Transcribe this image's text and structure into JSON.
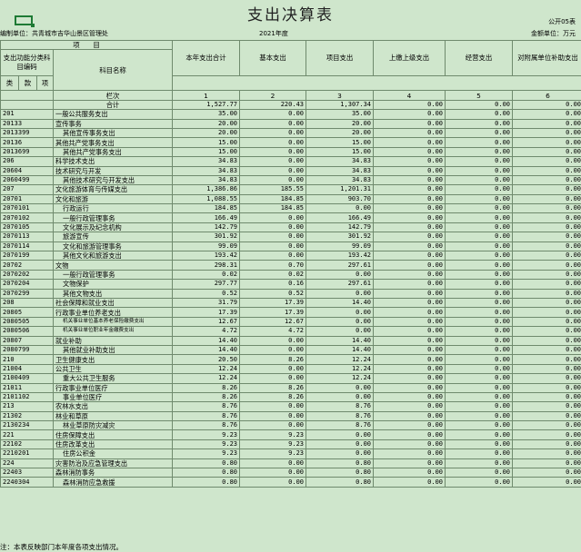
{
  "sheet": {
    "title": "支出决算表",
    "form_code": "公开05表",
    "unit_label": "编制单位：",
    "unit_name": "共青城市吉华山景区管理处",
    "year": "2021年度",
    "money_unit": "金额单位：万元",
    "note": "注：本表反映部门本年度各项支出情况。"
  },
  "header": {
    "item": "项　　目",
    "code_col": "支出功能分类科目编码",
    "name_col": "科目名称",
    "total_col": "本年支出合计",
    "basic_col": "基本支出",
    "project_col": "项目支出",
    "upper_col": "上缴上级支出",
    "business_col": "经营支出",
    "subsidy_col": "对附属单位补助支出",
    "lei": "类",
    "kuan": "款",
    "xiang": "项",
    "row_label": "栏次",
    "col_nums": [
      "1",
      "2",
      "3",
      "4",
      "5",
      "6"
    ]
  },
  "rows": [
    {
      "code": "",
      "name": "合计",
      "total": "1,527.77",
      "basic": "220.43",
      "project": "1,307.34",
      "upper": "0.00",
      "business": "0.00",
      "subsidy": "0.00",
      "style": "ctr"
    },
    {
      "code": "201",
      "name": "一般公共服务支出",
      "total": "35.00",
      "basic": "0.00",
      "project": "35.00",
      "upper": "0.00",
      "business": "0.00",
      "subsidy": "0.00",
      "style": ""
    },
    {
      "code": "20133",
      "name": "宣传事务",
      "total": "20.00",
      "basic": "0.00",
      "project": "20.00",
      "upper": "0.00",
      "business": "0.00",
      "subsidy": "0.00",
      "style": ""
    },
    {
      "code": "2013399",
      "name": "其他宣传事务支出",
      "total": "20.00",
      "basic": "0.00",
      "project": "20.00",
      "upper": "0.00",
      "business": "0.00",
      "subsidy": "0.00",
      "style": "ind1"
    },
    {
      "code": "20136",
      "name": "其他共产党事务支出",
      "total": "15.00",
      "basic": "0.00",
      "project": "15.00",
      "upper": "0.00",
      "business": "0.00",
      "subsidy": "0.00",
      "style": ""
    },
    {
      "code": "2013699",
      "name": "其他共产党事务支出",
      "total": "15.00",
      "basic": "0.00",
      "project": "15.00",
      "upper": "0.00",
      "business": "0.00",
      "subsidy": "0.00",
      "style": "ind1"
    },
    {
      "code": "206",
      "name": "科学技术支出",
      "total": "34.83",
      "basic": "0.00",
      "project": "34.83",
      "upper": "0.00",
      "business": "0.00",
      "subsidy": "0.00",
      "style": ""
    },
    {
      "code": "20604",
      "name": "技术研究与开发",
      "total": "34.83",
      "basic": "0.00",
      "project": "34.83",
      "upper": "0.00",
      "business": "0.00",
      "subsidy": "0.00",
      "style": ""
    },
    {
      "code": "2060499",
      "name": "其他技术研究与开发支出",
      "total": "34.83",
      "basic": "0.00",
      "project": "34.83",
      "upper": "0.00",
      "business": "0.00",
      "subsidy": "0.00",
      "style": "ind1"
    },
    {
      "code": "207",
      "name": "文化旅游体育与传媒支出",
      "total": "1,386.86",
      "basic": "185.55",
      "project": "1,201.31",
      "upper": "0.00",
      "business": "0.00",
      "subsidy": "0.00",
      "style": ""
    },
    {
      "code": "20701",
      "name": "文化和旅游",
      "total": "1,088.55",
      "basic": "184.85",
      "project": "903.70",
      "upper": "0.00",
      "business": "0.00",
      "subsidy": "0.00",
      "style": ""
    },
    {
      "code": "2070101",
      "name": "行政运行",
      "total": "184.85",
      "basic": "184.85",
      "project": "0.00",
      "upper": "0.00",
      "business": "0.00",
      "subsidy": "0.00",
      "style": "ind1"
    },
    {
      "code": "2070102",
      "name": "一般行政管理事务",
      "total": "166.49",
      "basic": "0.00",
      "project": "166.49",
      "upper": "0.00",
      "business": "0.00",
      "subsidy": "0.00",
      "style": "ind1"
    },
    {
      "code": "2070105",
      "name": "文化展示及纪念机构",
      "total": "142.79",
      "basic": "0.00",
      "project": "142.79",
      "upper": "0.00",
      "business": "0.00",
      "subsidy": "0.00",
      "style": "ind1"
    },
    {
      "code": "2070113",
      "name": "旅游宣传",
      "total": "301.92",
      "basic": "0.00",
      "project": "301.92",
      "upper": "0.00",
      "business": "0.00",
      "subsidy": "0.00",
      "style": "ind1"
    },
    {
      "code": "2070114",
      "name": "文化和旅游管理事务",
      "total": "99.09",
      "basic": "0.00",
      "project": "99.09",
      "upper": "0.00",
      "business": "0.00",
      "subsidy": "0.00",
      "style": "ind1"
    },
    {
      "code": "2070199",
      "name": "其他文化和旅游支出",
      "total": "193.42",
      "basic": "0.00",
      "project": "193.42",
      "upper": "0.00",
      "business": "0.00",
      "subsidy": "0.00",
      "style": "ind1"
    },
    {
      "code": "20702",
      "name": "文物",
      "total": "298.31",
      "basic": "0.70",
      "project": "297.61",
      "upper": "0.00",
      "business": "0.00",
      "subsidy": "0.00",
      "style": ""
    },
    {
      "code": "2070202",
      "name": "一般行政管理事务",
      "total": "0.02",
      "basic": "0.02",
      "project": "0.00",
      "upper": "0.00",
      "business": "0.00",
      "subsidy": "0.00",
      "style": "ind1"
    },
    {
      "code": "2070204",
      "name": "文物保护",
      "total": "297.77",
      "basic": "0.16",
      "project": "297.61",
      "upper": "0.00",
      "business": "0.00",
      "subsidy": "0.00",
      "style": "ind1"
    },
    {
      "code": "2070299",
      "name": "其他文物支出",
      "total": "0.52",
      "basic": "0.52",
      "project": "0.00",
      "upper": "0.00",
      "business": "0.00",
      "subsidy": "0.00",
      "style": "ind1"
    },
    {
      "code": "208",
      "name": "社会保障和就业支出",
      "total": "31.79",
      "basic": "17.39",
      "project": "14.40",
      "upper": "0.00",
      "business": "0.00",
      "subsidy": "0.00",
      "style": ""
    },
    {
      "code": "20805",
      "name": "行政事业单位养老支出",
      "total": "17.39",
      "basic": "17.39",
      "project": "0.00",
      "upper": "0.00",
      "business": "0.00",
      "subsidy": "0.00",
      "style": ""
    },
    {
      "code": "2080505",
      "name": "机关事业单位基本养老保险缴费支出",
      "total": "12.67",
      "basic": "12.67",
      "project": "0.00",
      "upper": "0.00",
      "business": "0.00",
      "subsidy": "0.00",
      "style": "tiny"
    },
    {
      "code": "2080506",
      "name": "机关事业单位职业年金缴费支出",
      "total": "4.72",
      "basic": "4.72",
      "project": "0.00",
      "upper": "0.00",
      "business": "0.00",
      "subsidy": "0.00",
      "style": "tiny"
    },
    {
      "code": "20807",
      "name": "就业补助",
      "total": "14.40",
      "basic": "0.00",
      "project": "14.40",
      "upper": "0.00",
      "business": "0.00",
      "subsidy": "0.00",
      "style": ""
    },
    {
      "code": "2080799",
      "name": "其他就业补助支出",
      "total": "14.40",
      "basic": "0.00",
      "project": "14.40",
      "upper": "0.00",
      "business": "0.00",
      "subsidy": "0.00",
      "style": "ind1"
    },
    {
      "code": "210",
      "name": "卫生健康支出",
      "total": "20.50",
      "basic": "8.26",
      "project": "12.24",
      "upper": "0.00",
      "business": "0.00",
      "subsidy": "0.00",
      "style": ""
    },
    {
      "code": "21004",
      "name": "公共卫生",
      "total": "12.24",
      "basic": "0.00",
      "project": "12.24",
      "upper": "0.00",
      "business": "0.00",
      "subsidy": "0.00",
      "style": ""
    },
    {
      "code": "2100409",
      "name": "重大公共卫生服务",
      "total": "12.24",
      "basic": "0.00",
      "project": "12.24",
      "upper": "0.00",
      "business": "0.00",
      "subsidy": "0.00",
      "style": "ind1"
    },
    {
      "code": "21011",
      "name": "行政事业单位医疗",
      "total": "8.26",
      "basic": "8.26",
      "project": "0.00",
      "upper": "0.00",
      "business": "0.00",
      "subsidy": "0.00",
      "style": ""
    },
    {
      "code": "2101102",
      "name": "事业单位医疗",
      "total": "8.26",
      "basic": "8.26",
      "project": "0.00",
      "upper": "0.00",
      "business": "0.00",
      "subsidy": "0.00",
      "style": "ind1"
    },
    {
      "code": "213",
      "name": "农林水支出",
      "total": "8.76",
      "basic": "0.00",
      "project": "8.76",
      "upper": "0.00",
      "business": "0.00",
      "subsidy": "0.00",
      "style": ""
    },
    {
      "code": "21302",
      "name": "林业和草原",
      "total": "8.76",
      "basic": "0.00",
      "project": "8.76",
      "upper": "0.00",
      "business": "0.00",
      "subsidy": "0.00",
      "style": ""
    },
    {
      "code": "2130234",
      "name": "林业草原防灾减灾",
      "total": "8.76",
      "basic": "0.00",
      "project": "8.76",
      "upper": "0.00",
      "business": "0.00",
      "subsidy": "0.00",
      "style": "ind1"
    },
    {
      "code": "221",
      "name": "住房保障支出",
      "total": "9.23",
      "basic": "9.23",
      "project": "0.00",
      "upper": "0.00",
      "business": "0.00",
      "subsidy": "0.00",
      "style": ""
    },
    {
      "code": "22102",
      "name": "住房改革支出",
      "total": "9.23",
      "basic": "9.23",
      "project": "0.00",
      "upper": "0.00",
      "business": "0.00",
      "subsidy": "0.00",
      "style": ""
    },
    {
      "code": "2210201",
      "name": "住房公积金",
      "total": "9.23",
      "basic": "9.23",
      "project": "0.00",
      "upper": "0.00",
      "business": "0.00",
      "subsidy": "0.00",
      "style": "ind1"
    },
    {
      "code": "224",
      "name": "灾害防治及应急管理支出",
      "total": "0.80",
      "basic": "0.00",
      "project": "0.80",
      "upper": "0.00",
      "business": "0.00",
      "subsidy": "0.00",
      "style": ""
    },
    {
      "code": "22403",
      "name": "森林消防事务",
      "total": "0.80",
      "basic": "0.00",
      "project": "0.80",
      "upper": "0.00",
      "business": "0.00",
      "subsidy": "0.00",
      "style": ""
    },
    {
      "code": "2240304",
      "name": "森林消防应急救援",
      "total": "0.80",
      "basic": "0.00",
      "project": "0.80",
      "upper": "0.00",
      "business": "0.00",
      "subsidy": "0.00",
      "style": "ind1"
    }
  ]
}
